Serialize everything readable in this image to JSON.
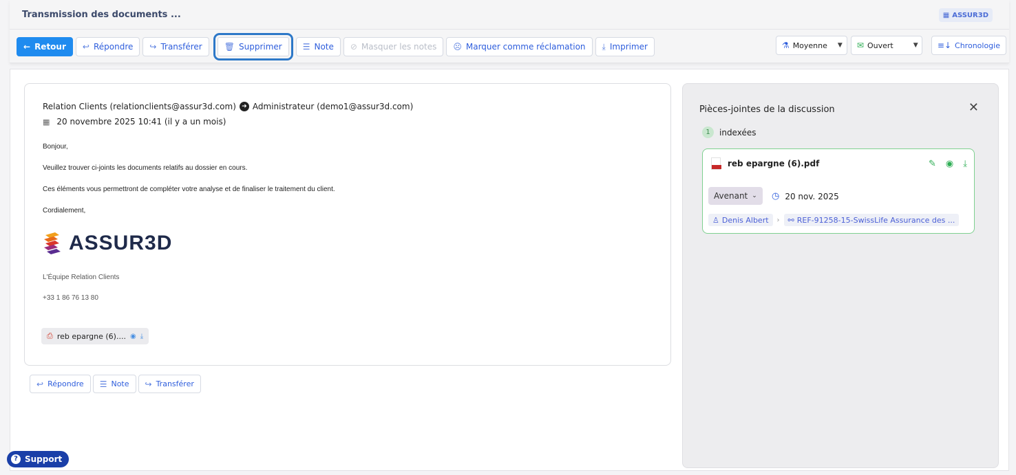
{
  "header": {
    "title": "Transmission des documents ...",
    "org_badge": "ASSUR3D"
  },
  "toolbar": {
    "back": "Retour",
    "reply": "Répondre",
    "forward": "Transférer",
    "delete": "Supprimer",
    "note": "Note",
    "hide_notes": "Masquer les notes",
    "mark_complaint": "Marquer comme réclamation",
    "print": "Imprimer",
    "priority": "Moyenne",
    "status": "Ouvert",
    "chronology": "Chronologie"
  },
  "mail": {
    "from": "Relation Clients (relationclients@assur3d.com)",
    "to": "Administrateur (demo1@assur3d.com)",
    "date": "20 novembre 2025 10:41 (il y a un mois)",
    "body": [
      "Bonjour,",
      "Veuillez trouver ci-joints les documents relatifs au dossier en cours.",
      "Ces éléments vous permettront de compléter votre analyse et de finaliser le traitement du client.",
      "Cordialement,"
    ],
    "logo_text": "ASSUR3D",
    "signature_team": "L'Équipe Relation Clients",
    "signature_phone": "+33 1 86 76 13 80",
    "attachment_chip": "reb epargne (6)...."
  },
  "reply_bar": {
    "reply": "Répondre",
    "note": "Note",
    "forward": "Transférer"
  },
  "panel": {
    "title": "Pièces-jointes de la discussion",
    "indexed_count": "1",
    "indexed_label": "indexées",
    "attachment": {
      "name": "reb epargne (6).pdf",
      "tag": "Avenant",
      "date": "20 nov. 2025",
      "person": "Denis Albert",
      "reference": "REF-91258-15-SwissLife Assurance des ..."
    }
  },
  "support": "Support",
  "colors": {
    "primary": "#1f8bef",
    "accent": "#2d5ddc",
    "success": "#2fae55",
    "support_bg": "#1a3fa8"
  }
}
